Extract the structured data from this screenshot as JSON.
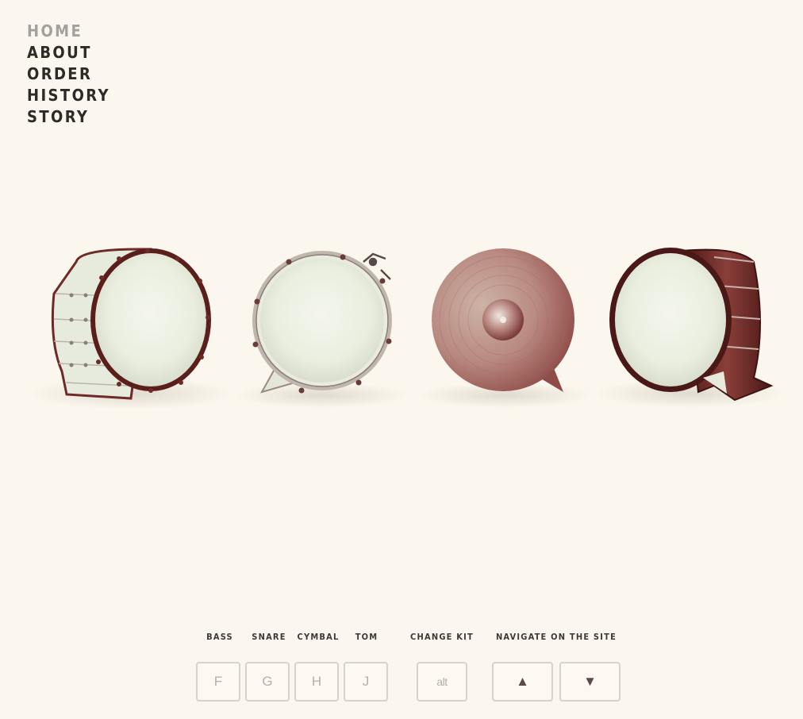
{
  "nav": {
    "items": [
      {
        "label": "HOME",
        "active": true
      },
      {
        "label": "ABOUT"
      },
      {
        "label": "ORDER"
      },
      {
        "label": "HISTORY"
      },
      {
        "label": "STORY"
      }
    ]
  },
  "kit": {
    "drums": [
      {
        "name": "bass-drum"
      },
      {
        "name": "snare-drum"
      },
      {
        "name": "cymbal"
      },
      {
        "name": "tom-drum"
      }
    ]
  },
  "controls": {
    "labels": {
      "bass": "BASS",
      "snare": "SNARE",
      "cymbal": "CYMBAL",
      "tom": "TOM",
      "change_kit": "CHANGE KIT",
      "navigate": "NAVIGATE ON THE SITE"
    },
    "keys": {
      "bass": "F",
      "snare": "G",
      "cymbal": "H",
      "tom": "J",
      "change_kit": "alt",
      "up": "▲",
      "down": "▼"
    }
  },
  "colors": {
    "background": "#fcf7ee",
    "drum_shell": "#6e2a26",
    "drum_head": "#eef0e4",
    "cymbal": "#b47c76"
  }
}
